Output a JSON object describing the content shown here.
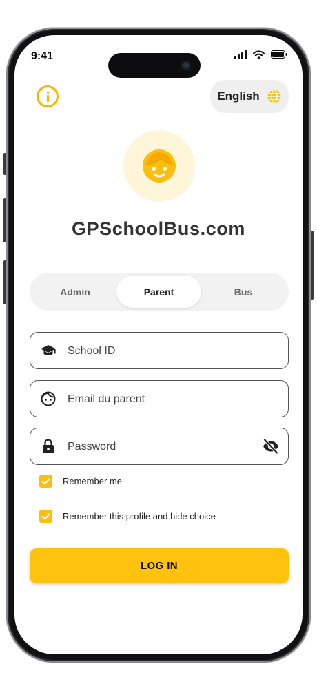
{
  "status_bar": {
    "time": "9:41"
  },
  "header": {
    "language": "English"
  },
  "app": {
    "title": "GPSchoolBus.com"
  },
  "tabs": [
    {
      "label": "Admin",
      "active": false
    },
    {
      "label": "Parent",
      "active": true
    },
    {
      "label": "Bus",
      "active": false
    }
  ],
  "form": {
    "school_id_placeholder": "School ID",
    "email_placeholder": "Email du parent",
    "password_placeholder": "Password"
  },
  "options": {
    "remember_me": "Remember me",
    "remember_profile": "Remember this profile and hide choice"
  },
  "login_label": "LOG IN",
  "colors": {
    "accent": "#ffc20e",
    "avatar_bg": "#fff6d9",
    "tab_bg": "#f2f2f2"
  }
}
